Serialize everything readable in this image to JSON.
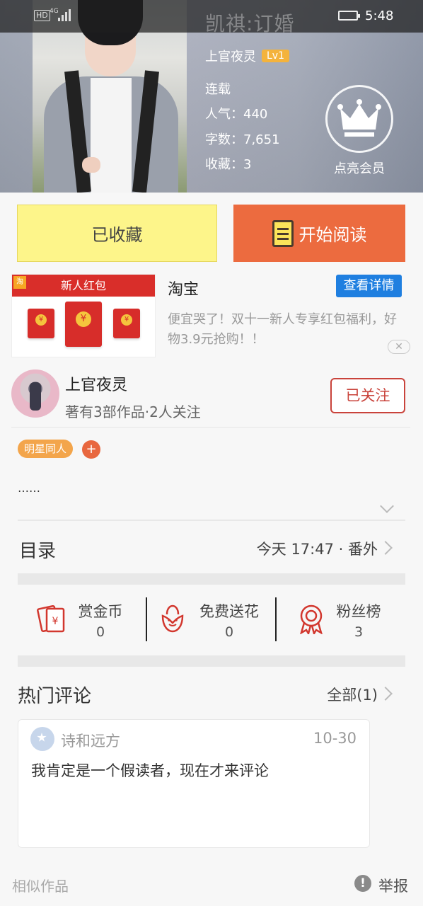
{
  "status_bar": {
    "hd": "HD",
    "network": "4G",
    "time": "5:48"
  },
  "book": {
    "title": "凯祺:订婚",
    "author": "上官夜灵",
    "level": "Lv1",
    "status": "连载",
    "popularity": "人气：440",
    "word_count": "字数：7,651",
    "favorites": "收藏：3",
    "vip_label": "点亮会员"
  },
  "actions": {
    "favorited_label": "已收藏",
    "read_label": "开始阅读"
  },
  "ad": {
    "image_title": "新人红包",
    "image_logo": "淘",
    "brand": "淘宝",
    "detail_button": "查看详情",
    "description": "便宜哭了！双十一新人专享红包福利，好物3.9元抢购！！"
  },
  "author_card": {
    "name": "上官夜灵",
    "subtitle": "著有3部作品·2人关注",
    "follow_label": "已关注"
  },
  "tags": [
    "明星同人"
  ],
  "tag_add": "+",
  "description": "……",
  "catalog": {
    "title": "目录",
    "latest": "今天 17:47 · 番外"
  },
  "stats": [
    {
      "label": "赏金币",
      "value": "0",
      "icon": "reward-coin-icon"
    },
    {
      "label": "免费送花",
      "value": "0",
      "icon": "flower-icon"
    },
    {
      "label": "粉丝榜",
      "value": "3",
      "icon": "medal-icon"
    }
  ],
  "comments": {
    "title": "热门评论",
    "all_label": "全部(1)",
    "items": [
      {
        "user": "诗和远方",
        "date": "10-30",
        "text": "我肯定是一个假读者，现在才来评论"
      }
    ]
  },
  "footer": {
    "similar": "相似作品",
    "report": "举报"
  },
  "colors": {
    "accent_orange": "#ec6b3f",
    "fav_yellow": "#fdf58a",
    "follow_red": "#c9433b",
    "link_blue": "#1f7fe0"
  }
}
